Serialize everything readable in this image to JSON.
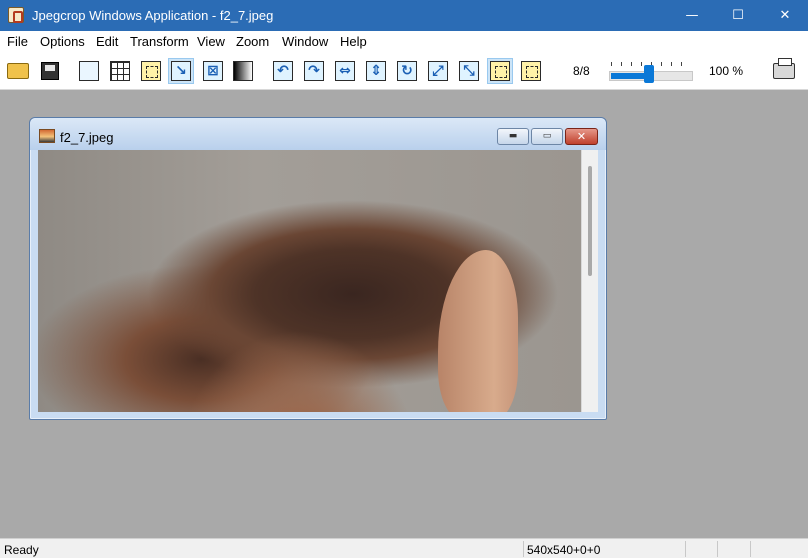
{
  "window": {
    "title": "Jpegcrop Windows Application - f2_7.jpeg",
    "app_icon": "jpegcrop-icon",
    "minimize_glyph": "—",
    "maximize_glyph": "☐",
    "close_glyph": "✕"
  },
  "menu": {
    "items": [
      "File",
      "Options",
      "Edit",
      "Transform",
      "View",
      "Zoom",
      "Window",
      "Help"
    ]
  },
  "toolbar": {
    "buttons": [
      {
        "icon": "open-folder-icon"
      },
      {
        "icon": "save-disk-icon"
      },
      {
        "icon": "copy-icon"
      },
      {
        "icon": "grid-icon"
      },
      {
        "icon": "crop-selection-icon"
      },
      {
        "icon": "fit-crop-icon",
        "pressed": true
      },
      {
        "icon": "crop-box-icon"
      },
      {
        "icon": "gradient-icon"
      },
      {
        "icon": "rotate-left-icon"
      },
      {
        "icon": "rotate-right-icon"
      },
      {
        "icon": "flip-horizontal-icon"
      },
      {
        "icon": "flip-vertical-icon"
      },
      {
        "icon": "rotate-90-icon"
      },
      {
        "icon": "transpose-icon"
      },
      {
        "icon": "transverse-icon"
      },
      {
        "icon": "selection-dashed-icon",
        "pressed": true
      },
      {
        "icon": "selection-dashed-alt-icon"
      },
      {
        "icon": "print-icon"
      }
    ],
    "page_counter": "8/8",
    "zoom_slider_fraction": 0.46,
    "zoom_readout": "100 %"
  },
  "child_window": {
    "title": "f2_7.jpeg",
    "icon": "image-file-icon",
    "minimize_glyph": "▬",
    "maximize_glyph": "▭",
    "close_glyph": "✕"
  },
  "status": {
    "left": "Ready",
    "dimensions": "540x540+0+0"
  }
}
